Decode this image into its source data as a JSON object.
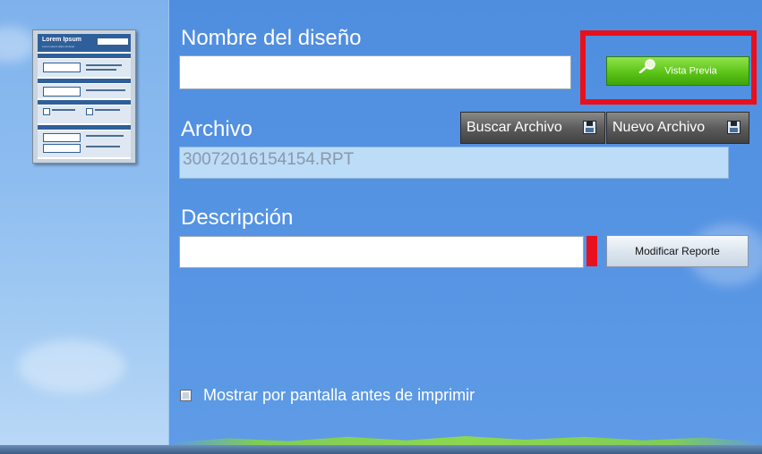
{
  "thumbnail": {
    "title": "Lorem Ipsum",
    "subtitle": "Lorem ipsum dolor sit amet",
    "lines": [
      "Nam sed lorem id amet",
      "Proin aliquet ipsum eu libero",
      "Nulla rhoncus cursus ipsum",
      "Curabitur eu velit",
      "Vestibulum semper dapibus lorem",
      "Pellentesque turpis diam"
    ]
  },
  "form": {
    "name_label": "Nombre del diseño",
    "name_value": "",
    "archivo_label": "Archivo",
    "archivo_value": "30072016154154.RPT",
    "descripcion_label": "Descripción",
    "descripcion_value": ""
  },
  "buttons": {
    "preview": "Vista Previa",
    "browse": "Buscar Archivo",
    "new_file": "Nuevo Archivo",
    "modify": "Modificar Reporte"
  },
  "options": {
    "show_before_print_label": "Mostrar por pantalla antes de imprimir",
    "show_before_print_checked": false
  },
  "colors": {
    "highlight": "#e8101c",
    "preview_button": "#5cc417",
    "background": "#4f8fe0"
  },
  "icons": {
    "preview": "magnifier-icon",
    "browse": "floppy-disk-icon",
    "new_file": "floppy-disk-icon"
  }
}
